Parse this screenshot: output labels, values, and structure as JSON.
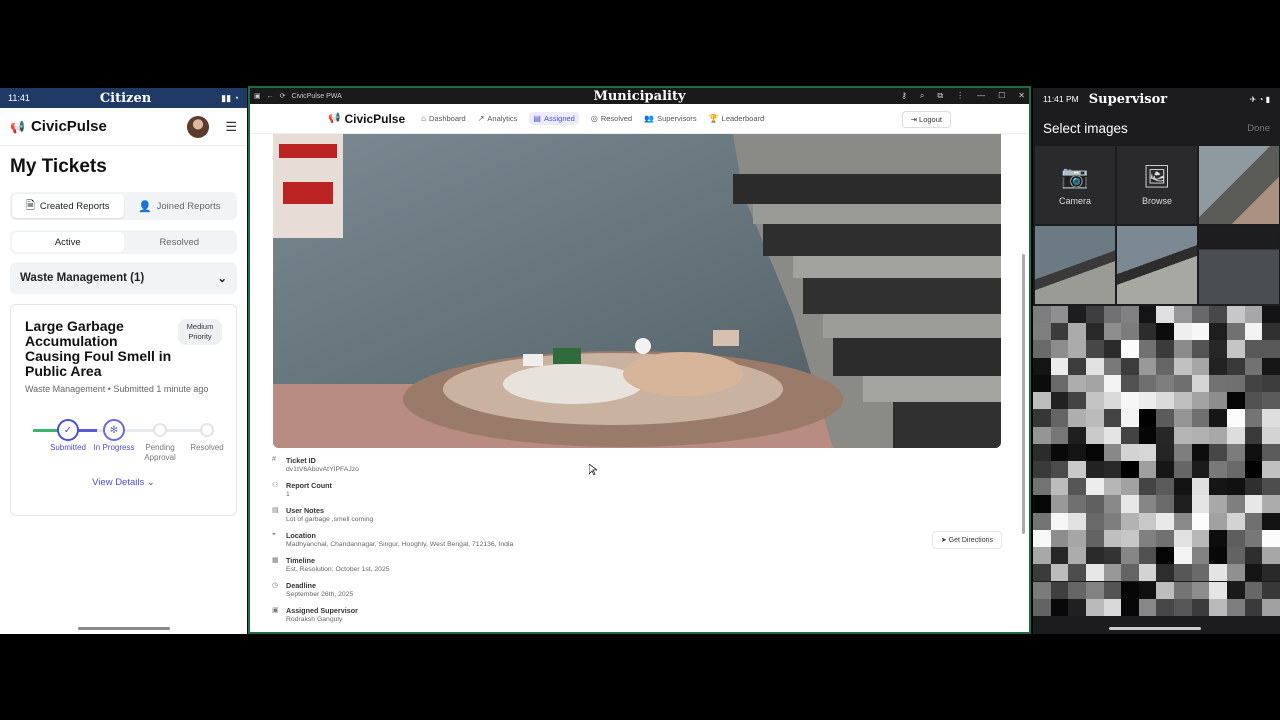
{
  "citizen": {
    "status_time": "11:41",
    "status_title": "Citizen",
    "brand": "CivicPulse",
    "page_title": "My Tickets",
    "tabs": [
      "Created Reports",
      "Joined Reports"
    ],
    "filters": [
      "Active",
      "Resolved"
    ],
    "category": "Waste Management (1)",
    "ticket": {
      "title": "Large Garbage Accumulation Causing Foul Smell in Public Area",
      "priority": "Medium Priority",
      "meta": "Waste Management • Submitted 1 minute ago",
      "steps": [
        "Submitted",
        "In Progress",
        "Pending Approval",
        "Resolved"
      ],
      "view_details": "View Details"
    }
  },
  "municipality": {
    "window_app": "CivicPulse PWA",
    "window_title": "Municipality",
    "brand": "CivicPulse",
    "nav": [
      "Dashboard",
      "Analytics",
      "Assigned",
      "Resolved",
      "Supervisors",
      "Leaderboard"
    ],
    "active_nav": "Assigned",
    "logout": "Logout",
    "details": [
      {
        "label": "Ticket ID",
        "value": "dv1tV6AbovAtYIPFAJzo",
        "icon": "hash-icon"
      },
      {
        "label": "Report Count",
        "value": "1",
        "icon": "users-icon"
      },
      {
        "label": "User Notes",
        "value": "Lot of garbage ,smell coming",
        "icon": "note-icon"
      },
      {
        "label": "Location",
        "value": "Madhyanchal, Chandannagar, Singur, Hooghly, West Bengal, 712136, India",
        "icon": "pin-icon"
      },
      {
        "label": "Timeline",
        "value": "Est. Resolution: October 1st, 2025",
        "icon": "calendar-icon"
      },
      {
        "label": "Deadline",
        "value": "September 26th, 2025",
        "icon": "clock-icon"
      },
      {
        "label": "Assigned Supervisor",
        "value": "Rodraksh Ganguly",
        "icon": "badge-icon"
      }
    ],
    "directions": "Get Directions"
  },
  "supervisor": {
    "status_time": "11:41 PM",
    "status_title": "Supervisor",
    "header": "Select images",
    "done": "Done",
    "camera": "Camera",
    "browse": "Browse"
  }
}
